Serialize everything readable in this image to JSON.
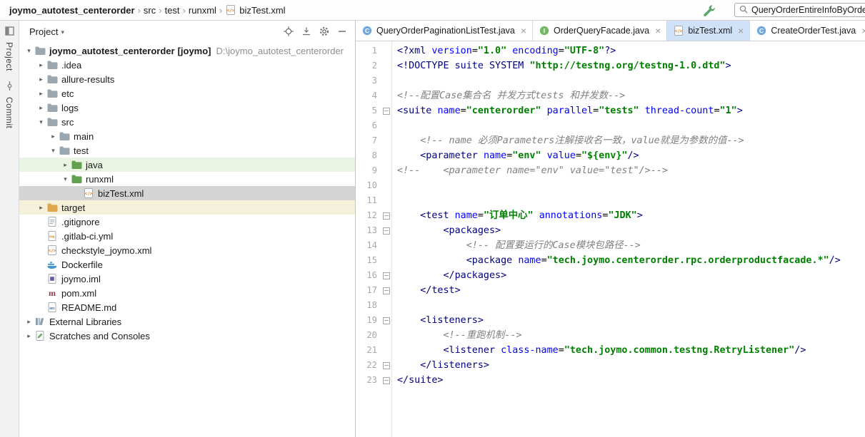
{
  "breadcrumb_bar": {
    "items": [
      {
        "label": "joymo_autotest_centerorder",
        "bold": true
      },
      {
        "label": "src"
      },
      {
        "label": "test"
      },
      {
        "label": "runxml"
      },
      {
        "label": "bizTest.xml",
        "icon": "xml-file"
      }
    ],
    "search_text": "QueryOrderEntireInfoByOrder"
  },
  "tool_stripe": {
    "buttons": [
      {
        "label": "Project"
      },
      {
        "label": "Commit"
      }
    ]
  },
  "project_panel": {
    "title": "Project",
    "tree": [
      {
        "indent": 0,
        "arrow": "down",
        "icon": "folder",
        "label": "joymo_autotest_centerorder",
        "suffix": " [joymo]",
        "path": "D:\\joymo_autotest_centerorder",
        "bold": true
      },
      {
        "indent": 1,
        "arrow": "right",
        "icon": "folder",
        "label": ".idea"
      },
      {
        "indent": 1,
        "arrow": "right",
        "icon": "folder",
        "label": "allure-results"
      },
      {
        "indent": 1,
        "arrow": "right",
        "icon": "folder",
        "label": "etc"
      },
      {
        "indent": 1,
        "arrow": "right",
        "icon": "folder",
        "label": "logs"
      },
      {
        "indent": 1,
        "arrow": "down",
        "icon": "folder",
        "label": "src"
      },
      {
        "indent": 2,
        "arrow": "right",
        "icon": "folder",
        "label": "main"
      },
      {
        "indent": 2,
        "arrow": "down",
        "icon": "folder",
        "label": "test"
      },
      {
        "indent": 3,
        "arrow": "right",
        "icon": "folder-green",
        "label": "java",
        "highlight": "green"
      },
      {
        "indent": 3,
        "arrow": "down",
        "icon": "folder-green",
        "label": "runxml"
      },
      {
        "indent": 4,
        "arrow": "none",
        "icon": "xml-file",
        "label": "bizTest.xml",
        "highlight": "selected"
      },
      {
        "indent": 1,
        "arrow": "right",
        "icon": "folder-orange",
        "label": "target",
        "highlight": "yellow"
      },
      {
        "indent": 1,
        "arrow": "none",
        "icon": "file-git",
        "label": ".gitignore"
      },
      {
        "indent": 1,
        "arrow": "none",
        "icon": "file-yml",
        "label": ".gitlab-ci.yml"
      },
      {
        "indent": 1,
        "arrow": "none",
        "icon": "xml-file",
        "label": "checkstyle_joymo.xml"
      },
      {
        "indent": 1,
        "arrow": "none",
        "icon": "file-docker",
        "label": "Dockerfile"
      },
      {
        "indent": 1,
        "arrow": "none",
        "icon": "file-iml",
        "label": "joymo.iml"
      },
      {
        "indent": 1,
        "arrow": "none",
        "icon": "file-maven",
        "label": "pom.xml"
      },
      {
        "indent": 1,
        "arrow": "none",
        "icon": "file-md",
        "label": "README.md"
      },
      {
        "indent": 0,
        "arrow": "right",
        "icon": "libraries",
        "label": "External Libraries"
      },
      {
        "indent": 0,
        "arrow": "right",
        "icon": "scratches",
        "label": "Scratches and Consoles"
      }
    ]
  },
  "editor": {
    "tabs": [
      {
        "icon": "class-blue",
        "label": "QueryOrderPaginationListTest.java",
        "active": false
      },
      {
        "icon": "interface-green",
        "label": "OrderQueryFacade.java",
        "active": false
      },
      {
        "icon": "xml-file",
        "label": "bizTest.xml",
        "active": true
      },
      {
        "icon": "class-blue",
        "label": "CreateOrderTest.java",
        "active": false
      }
    ],
    "lines": [
      {
        "n": 1,
        "fold": null,
        "t": [
          [
            "tag",
            "<?xml "
          ],
          [
            "attr",
            "version"
          ],
          [
            "plain",
            "="
          ],
          [
            "val",
            "\"1.0\""
          ],
          [
            "plain",
            " "
          ],
          [
            "attr",
            "encoding"
          ],
          [
            "plain",
            "="
          ],
          [
            "val",
            "\"UTF-8\""
          ],
          [
            "tag",
            "?>"
          ]
        ]
      },
      {
        "n": 2,
        "fold": null,
        "t": [
          [
            "tag",
            "<!DOCTYPE suite SYSTEM "
          ],
          [
            "val",
            "\"http://testng.org/testng-1.0.dtd\""
          ],
          [
            "tag",
            ">"
          ]
        ]
      },
      {
        "n": 3,
        "fold": null,
        "t": []
      },
      {
        "n": 4,
        "fold": null,
        "t": [
          [
            "com",
            "<!--配置Case集合名 并发方式tests 和并发数-->"
          ]
        ]
      },
      {
        "n": 5,
        "fold": "start",
        "t": [
          [
            "tag",
            "<suite "
          ],
          [
            "attr",
            "name"
          ],
          [
            "plain",
            "="
          ],
          [
            "val",
            "\"centerorder\""
          ],
          [
            "plain",
            " "
          ],
          [
            "attr",
            "parallel"
          ],
          [
            "plain",
            "="
          ],
          [
            "val",
            "\"tests\""
          ],
          [
            "plain",
            " "
          ],
          [
            "attr",
            "thread-count"
          ],
          [
            "plain",
            "="
          ],
          [
            "val",
            "\"1\""
          ],
          [
            "tag",
            ">"
          ]
        ]
      },
      {
        "n": 6,
        "fold": null,
        "t": []
      },
      {
        "n": 7,
        "fold": null,
        "t": [
          [
            "plain",
            "    "
          ],
          [
            "com",
            "<!-- name 必须Parameters注解接收名一致，value就是为参数的值-->"
          ]
        ]
      },
      {
        "n": 8,
        "fold": null,
        "t": [
          [
            "plain",
            "    "
          ],
          [
            "tag",
            "<parameter "
          ],
          [
            "attr",
            "name"
          ],
          [
            "plain",
            "="
          ],
          [
            "val",
            "\"env\""
          ],
          [
            "plain",
            " "
          ],
          [
            "attr",
            "value"
          ],
          [
            "plain",
            "="
          ],
          [
            "val",
            "\"${env}\""
          ],
          [
            "tag",
            "/>"
          ]
        ]
      },
      {
        "n": 9,
        "fold": null,
        "t": [
          [
            "com",
            "<!--    <parameter name=\"env\" value=\"test\"/>-->"
          ]
        ]
      },
      {
        "n": 10,
        "fold": null,
        "t": []
      },
      {
        "n": 11,
        "fold": null,
        "t": []
      },
      {
        "n": 12,
        "fold": "start",
        "t": [
          [
            "plain",
            "    "
          ],
          [
            "tag",
            "<test "
          ],
          [
            "attr",
            "name"
          ],
          [
            "plain",
            "="
          ],
          [
            "val",
            "\"订单中心\""
          ],
          [
            "plain",
            " "
          ],
          [
            "attr",
            "annotations"
          ],
          [
            "plain",
            "="
          ],
          [
            "val",
            "\"JDK\""
          ],
          [
            "tag",
            ">"
          ]
        ]
      },
      {
        "n": 13,
        "fold": "start",
        "t": [
          [
            "plain",
            "        "
          ],
          [
            "tag",
            "<packages>"
          ]
        ]
      },
      {
        "n": 14,
        "fold": null,
        "t": [
          [
            "plain",
            "            "
          ],
          [
            "com",
            "<!-- 配置要运行的Case模块包路径-->"
          ]
        ]
      },
      {
        "n": 15,
        "fold": null,
        "t": [
          [
            "plain",
            "            "
          ],
          [
            "tag",
            "<package "
          ],
          [
            "attr",
            "name"
          ],
          [
            "plain",
            "="
          ],
          [
            "val",
            "\"tech.joymo.centerorder.rpc.orderproductfacade.*\""
          ],
          [
            "tag",
            "/>"
          ]
        ]
      },
      {
        "n": 16,
        "fold": "end",
        "t": [
          [
            "plain",
            "        "
          ],
          [
            "tag",
            "</packages>"
          ]
        ]
      },
      {
        "n": 17,
        "fold": "end",
        "t": [
          [
            "plain",
            "    "
          ],
          [
            "tag",
            "</test>"
          ]
        ]
      },
      {
        "n": 18,
        "fold": null,
        "t": []
      },
      {
        "n": 19,
        "fold": "start",
        "t": [
          [
            "plain",
            "    "
          ],
          [
            "tag",
            "<listeners>"
          ]
        ]
      },
      {
        "n": 20,
        "fold": null,
        "t": [
          [
            "plain",
            "        "
          ],
          [
            "com",
            "<!--重跑机制-->"
          ]
        ]
      },
      {
        "n": 21,
        "fold": null,
        "t": [
          [
            "plain",
            "        "
          ],
          [
            "tag",
            "<listener "
          ],
          [
            "attr",
            "class-name"
          ],
          [
            "plain",
            "="
          ],
          [
            "val",
            "\"tech.joymo.common.testng.RetryListener\""
          ],
          [
            "tag",
            "/>"
          ]
        ]
      },
      {
        "n": 22,
        "fold": "end",
        "t": [
          [
            "plain",
            "    "
          ],
          [
            "tag",
            "</listeners>"
          ]
        ]
      },
      {
        "n": 23,
        "fold": "end",
        "t": [
          [
            "tag",
            "</suite>"
          ]
        ]
      }
    ]
  },
  "colors": {
    "selection_row": "#D4D4D4",
    "test_scope_row": "#E9F5E2",
    "excluded_scope_row": "#F5F0D9",
    "active_tab": "#D0E2F7",
    "xml_tag": "#000080",
    "xml_attribute": "#0000FF",
    "xml_value": "#008000",
    "xml_comment": "#808080",
    "accent_green": "#59A869"
  }
}
